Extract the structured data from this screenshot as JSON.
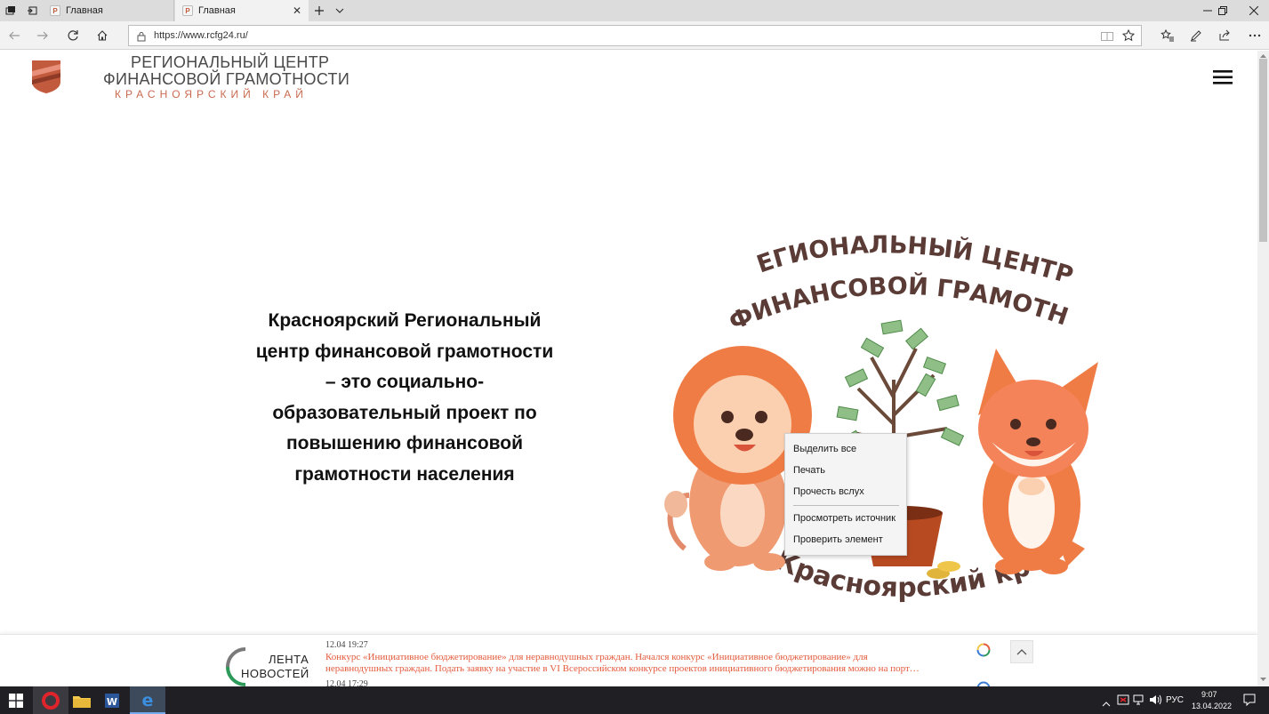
{
  "browser": {
    "tabs": [
      {
        "label": "Главная"
      },
      {
        "label": "Главная"
      }
    ],
    "address": {
      "url": "https://www.rcfg24.ru/"
    }
  },
  "header": {
    "logo_line1": "РЕГИОНАЛЬНЫЙ ЦЕНТР",
    "logo_line2": "ФИНАНСОВОЙ ГРАМОТНОСТИ",
    "logo_line3": "КРАСНОЯРСКИЙ КРАЙ"
  },
  "hero": {
    "lines": [
      "Красноярский Региональный",
      "центр финансовой грамотности",
      "– это социально-",
      "образовательный проект по",
      "повышению финансовой",
      "грамотности населения"
    ]
  },
  "illustration": {
    "arc_top_line1": "ЕГИОНАЛЬНЫЙ ЦЕНТР",
    "arc_top_line2": "ФИНАНСОВОЙ ГРАМОТНОСТИ",
    "arc_bottom": "Красноярский край"
  },
  "context_menu": {
    "items": [
      {
        "label": "Выделить все"
      },
      {
        "label": "Печать"
      },
      {
        "label": "Прочесть вслух"
      },
      {
        "label": "Просмотреть источник"
      },
      {
        "label": "Проверить элемент"
      }
    ]
  },
  "news_ticker": {
    "logo_line1": "ЛЕНТА",
    "logo_line2": "НОВОСТЕЙ",
    "items": [
      {
        "time": "12.04  19:27",
        "text_line1": "Конкурс «Инициативное бюджетирование» для неравнодушных граждан. Начался конкурс «Инициативное бюджетирование» для",
        "text_line2": "неравнодушных граждан. Подать заявку на участие в VI Всероссийском конкурсе проектов инициативного бюджетирования можно на порт…"
      },
      {
        "time": "12.04  17:29"
      }
    ]
  },
  "taskbar": {
    "lang": "РУС",
    "time": "9:07",
    "date": "13.04.2022"
  },
  "colors": {
    "brand_red": "#c25b3e",
    "news_orange": "#e45a3c",
    "arc_text": "#5a3b36"
  }
}
